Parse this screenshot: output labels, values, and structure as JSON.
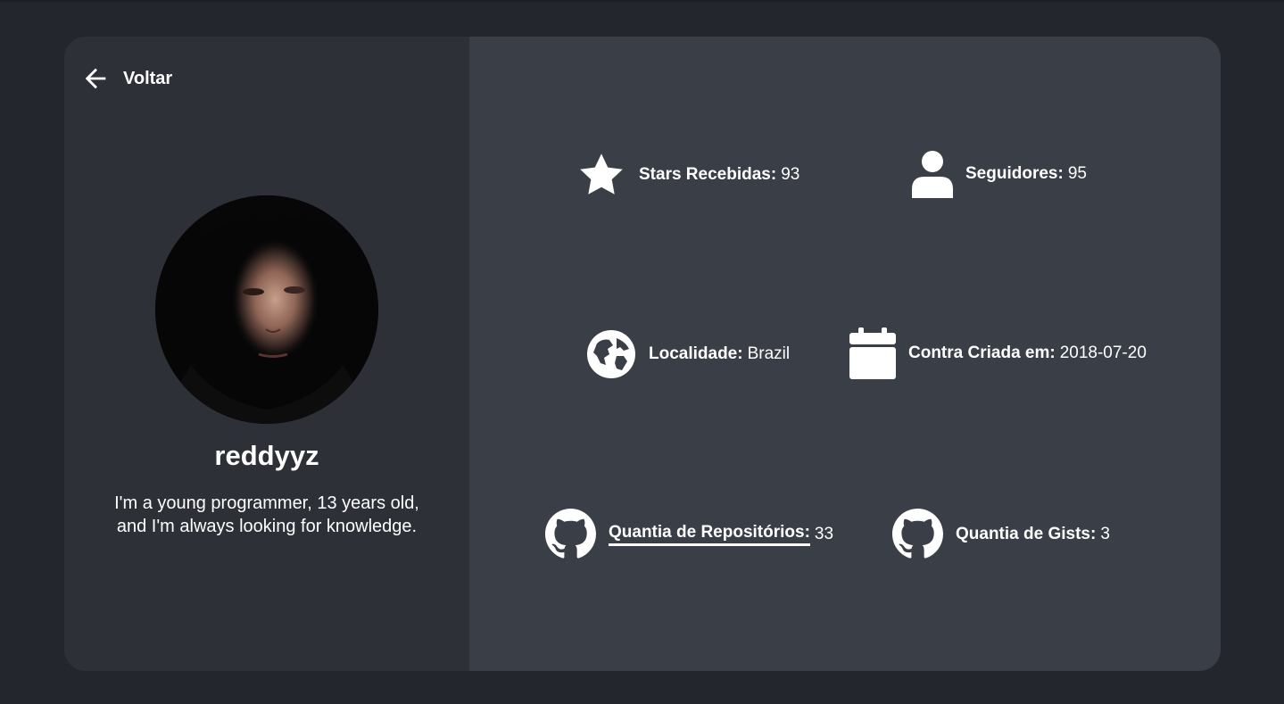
{
  "nav": {
    "back_label": "Voltar"
  },
  "profile": {
    "username": "reddyyz",
    "bio": "I'm a young programmer, 13 years old, and I'm always looking for knowledge."
  },
  "stats": {
    "stars": {
      "label": "Stars Recebidas:",
      "value": "93",
      "icon": "star-icon"
    },
    "followers": {
      "label": "Seguidores:",
      "value": "95",
      "icon": "user-icon"
    },
    "location": {
      "label": "Localidade:",
      "value": "Brazil",
      "icon": "globe-icon"
    },
    "created": {
      "label": "Contra Criada em:",
      "value": "2018-07-20",
      "icon": "calendar-icon"
    },
    "repos": {
      "label": "Quantia de Repositórios:",
      "value": "33",
      "icon": "github-icon"
    },
    "gists": {
      "label": "Quantia de Gists:",
      "value": "3",
      "icon": "github-icon"
    }
  },
  "colors": {
    "background": "#23272d",
    "left_panel": "#2d3037",
    "right_panel": "#393e47",
    "text": "#ffffff"
  }
}
